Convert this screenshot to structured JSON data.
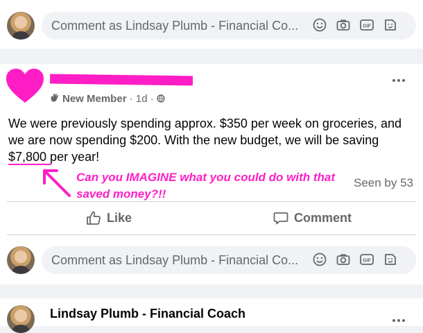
{
  "top_comment_bar": {
    "placeholder": "Comment as Lindsay Plumb - Financial Co..."
  },
  "post": {
    "author_name": "",
    "badge": "New Member",
    "time": "1d",
    "text": "We were previously spending approx. $350 per week on groceries, and we are now spending $200. With the new budget, we will be saving $7,800 per year!",
    "annotation": "Can you IMAGINE what you could do with that saved money?!!",
    "annotation_color": "#ff1ec6",
    "seen_by": "Seen by 53",
    "like_label": "Like",
    "comment_label": "Comment"
  },
  "post_comment_bar": {
    "placeholder": "Comment as Lindsay Plumb - Financial Co..."
  },
  "next_post": {
    "author_name": "Lindsay Plumb - Financial Coach"
  },
  "icons": [
    "emoji-icon",
    "camera-icon",
    "gif-icon",
    "sticker-icon",
    "wave-icon",
    "globe-icon",
    "more-icon",
    "like-icon",
    "comment-icon",
    "heart-icon"
  ],
  "colors": {
    "background": "#f0f2f5",
    "card": "#ffffff",
    "secondary_text": "#65676b",
    "highlight": "#ff1ec6"
  }
}
